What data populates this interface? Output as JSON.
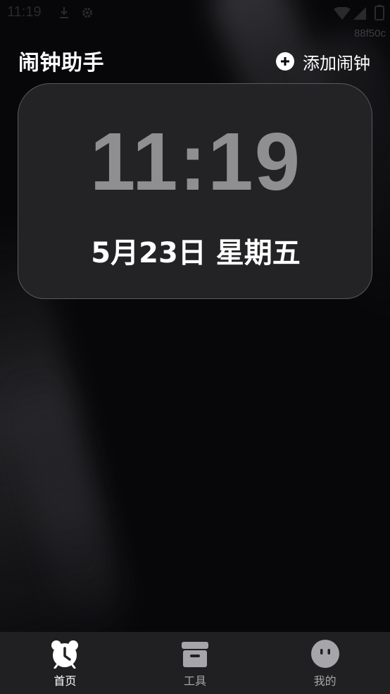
{
  "status_bar": {
    "time": "11:19",
    "icons": [
      "download-icon",
      "gear-icon",
      "wifi-icon",
      "signal-icon",
      "battery-icon"
    ]
  },
  "build_tag": "88f50c",
  "header": {
    "title": "闹钟助手",
    "add_label": "添加闹钟",
    "add_icon": "plus-circle-icon"
  },
  "clock": {
    "time": "11:19",
    "date": "5月23日 星期五"
  },
  "tabs": [
    {
      "label": "首页",
      "icon": "alarm-clock-icon",
      "active": true
    },
    {
      "label": "工具",
      "icon": "archive-box-icon",
      "active": false
    },
    {
      "label": "我的",
      "icon": "face-icon",
      "active": false
    }
  ],
  "colors": {
    "background": "#070709",
    "card": "#232325",
    "clock_time": "#8f8f92",
    "tab_bar": "#202022",
    "text": "#ffffff",
    "inactive": "#a6a6aa"
  }
}
